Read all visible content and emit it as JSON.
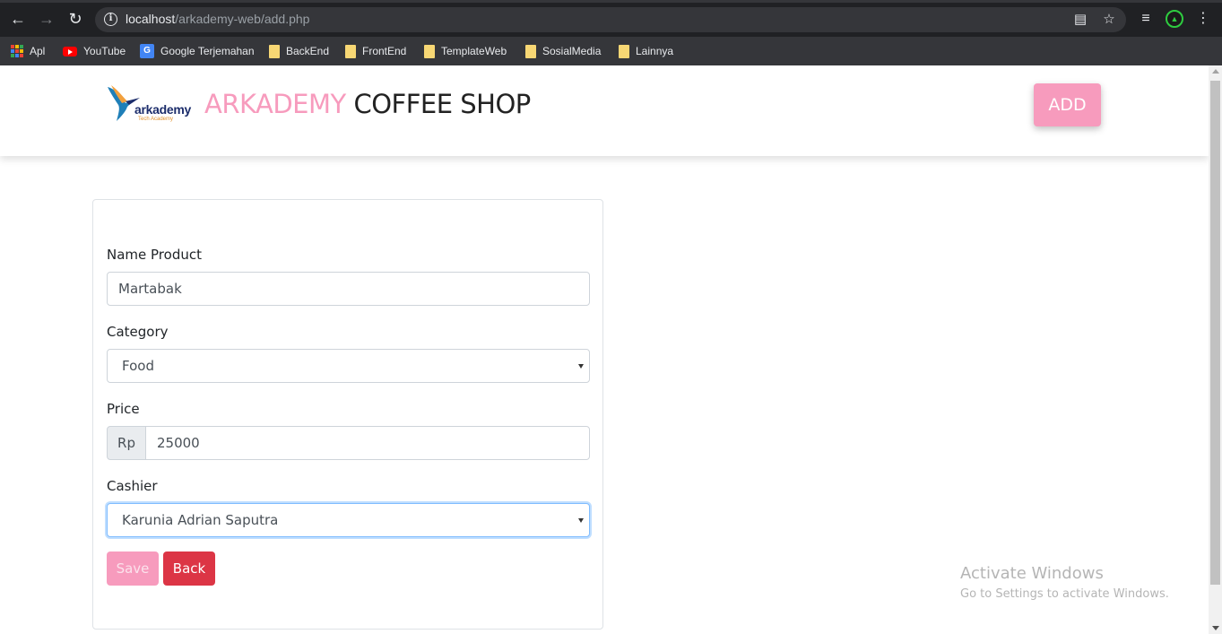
{
  "browser": {
    "url_host": "localhost",
    "url_path": "/arkademy-web/add.php",
    "bookmarks": [
      {
        "label": "Apl",
        "icon": "apps-grid-icon"
      },
      {
        "label": "YouTube",
        "icon": "youtube-icon"
      },
      {
        "label": "Google Terjemahan",
        "icon": "google-translate-icon"
      },
      {
        "label": "BackEnd",
        "icon": "folder-icon"
      },
      {
        "label": "FrontEnd",
        "icon": "folder-icon"
      },
      {
        "label": "TemplateWeb",
        "icon": "folder-icon"
      },
      {
        "label": "SosialMedia",
        "icon": "folder-icon"
      },
      {
        "label": "Lainnya",
        "icon": "folder-icon"
      }
    ],
    "colors": {
      "chrome_bg": "#202124",
      "bookmark_bg": "#35363a"
    }
  },
  "header": {
    "logo_text": "arkademy",
    "logo_subtext": "Tech Academy",
    "title_part1": "ARKADEMY",
    "title_part2": "COFFEE SHOP",
    "add_button": "ADD",
    "colors": {
      "accent": "#f79bbd",
      "title_dark": "#222222"
    }
  },
  "form": {
    "name_label": "Name Product",
    "name_value": "Martabak",
    "category_label": "Category",
    "category_value": "Food",
    "price_label": "Price",
    "price_prefix": "Rp",
    "price_value": "25000",
    "cashier_label": "Cashier",
    "cashier_value": "Karunia Adrian Saputra",
    "save_button": "Save",
    "back_button": "Back"
  },
  "watermark": {
    "line1": "Activate Windows",
    "line2": "Go to Settings to activate Windows."
  }
}
